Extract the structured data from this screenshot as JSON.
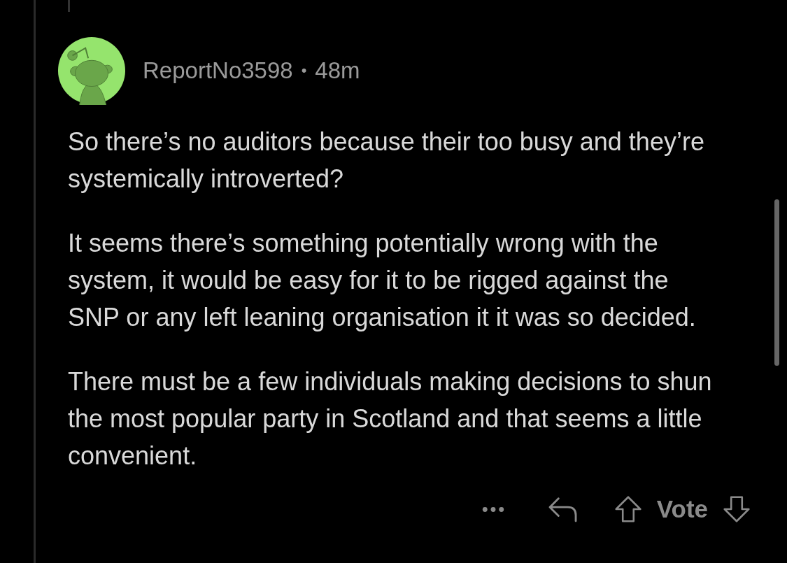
{
  "comment": {
    "author": "ReportNo3598",
    "separator": "•",
    "age": "48m",
    "paragraphs": [
      "So there’s no auditors because their too busy and they’re systemically introverted?",
      "It seems there’s something potentially wrong with the system, it would be easy for it to be rigged against the SNP or any left leaning organisation it it was so decided.",
      "There must be a few individuals making decisions to shun the most popular party in Scotland and that seems a little convenient."
    ]
  },
  "actions": {
    "vote_label": "Vote"
  }
}
